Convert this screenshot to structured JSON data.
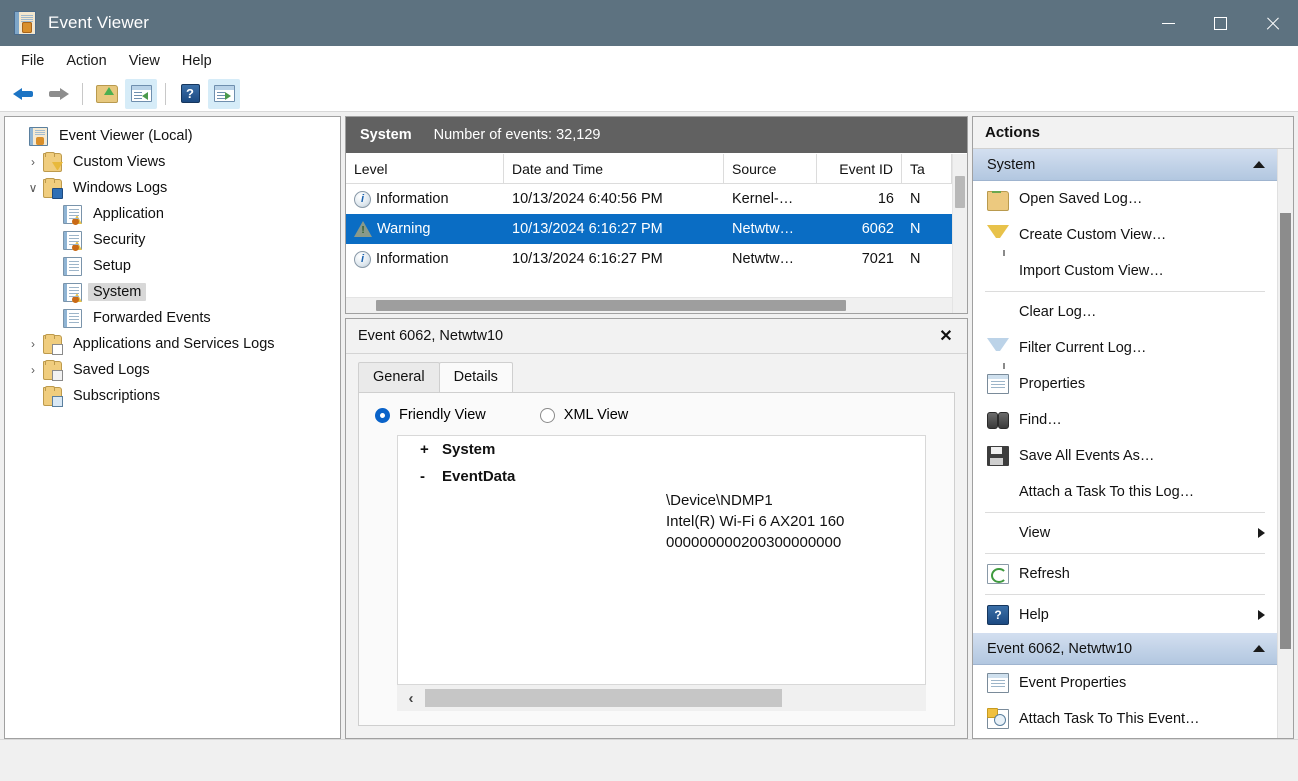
{
  "window": {
    "title": "Event Viewer",
    "icon": "event-viewer-icon",
    "controls": {
      "minimize": "–",
      "maximize": "□",
      "close": "✕"
    },
    "titlebar_color": "#5d7280"
  },
  "menubar": {
    "items": [
      {
        "label": "File"
      },
      {
        "label": "Action"
      },
      {
        "label": "View"
      },
      {
        "label": "Help"
      }
    ]
  },
  "toolbar": {
    "items": [
      {
        "name": "back-button",
        "icon": "arrow-left-icon",
        "active": false
      },
      {
        "name": "forward-button",
        "icon": "arrow-right-icon",
        "active": false
      },
      {
        "name": "up-one-level-button",
        "icon": "folder-up-icon",
        "active": false
      },
      {
        "name": "show-hide-console-tree-button",
        "icon": "pane-left-icon",
        "active": true
      },
      {
        "name": "help-button",
        "icon": "help-icon",
        "active": false,
        "glyph": "?"
      },
      {
        "name": "show-hide-action-pane-button",
        "icon": "pane-right-icon",
        "active": true
      }
    ]
  },
  "tree": {
    "items": [
      {
        "label": "Event Viewer (Local)",
        "icon": "event-log-icon",
        "indent": 0,
        "chevron": "",
        "selected": false
      },
      {
        "label": "Custom Views",
        "icon": "folder-filter-icon",
        "indent": 1,
        "chevron": "›",
        "selected": false
      },
      {
        "label": "Windows Logs",
        "icon": "folder-monitor-icon",
        "indent": 1,
        "chevron": "∨",
        "selected": false
      },
      {
        "label": "Application",
        "icon": "log-warning-icon",
        "indent": 2,
        "chevron": "",
        "selected": false
      },
      {
        "label": "Security",
        "icon": "log-warning-icon",
        "indent": 2,
        "chevron": "",
        "selected": false
      },
      {
        "label": "Setup",
        "icon": "log-icon",
        "indent": 2,
        "chevron": "",
        "selected": false
      },
      {
        "label": "System",
        "icon": "log-warning-icon",
        "indent": 2,
        "chevron": "",
        "selected": true
      },
      {
        "label": "Forwarded Events",
        "icon": "log-icon",
        "indent": 2,
        "chevron": "",
        "selected": false
      },
      {
        "label": "Applications and Services Logs",
        "icon": "folder-doc-icon",
        "indent": 1,
        "chevron": "›",
        "selected": false
      },
      {
        "label": "Saved Logs",
        "icon": "folder-docs-icon",
        "indent": 1,
        "chevron": "›",
        "selected": false
      },
      {
        "label": "Subscriptions",
        "icon": "folder-subscription-icon",
        "indent": 1,
        "chevron": "",
        "selected": false
      }
    ]
  },
  "event_list": {
    "banner_name": "System",
    "banner_count": "Number of events: 32,129",
    "columns": [
      "Level",
      "Date and Time",
      "Source",
      "Event ID",
      "Ta"
    ],
    "rows": [
      {
        "level": "Information",
        "level_icon": "information-icon",
        "date": "10/13/2024 6:40:56 PM",
        "source": "Kernel-…",
        "event_id": "16",
        "task": "N",
        "selected": false
      },
      {
        "level": "Warning",
        "level_icon": "warning-icon",
        "date": "10/13/2024 6:16:27 PM",
        "source": "Netwtw…",
        "event_id": "6062",
        "task": "N",
        "selected": true
      },
      {
        "level": "Information",
        "level_icon": "information-icon",
        "date": "10/13/2024 6:16:27 PM",
        "source": "Netwtw…",
        "event_id": "7021",
        "task": "N",
        "selected": false
      }
    ]
  },
  "detail": {
    "title": "Event 6062, Netwtw10",
    "close_label": "✕",
    "tabs": [
      {
        "label": "General",
        "active": false
      },
      {
        "label": "Details",
        "active": true
      }
    ],
    "view_options": [
      {
        "label": "Friendly View",
        "selected": true
      },
      {
        "label": "XML View",
        "selected": false
      }
    ],
    "xml": {
      "nodes": [
        {
          "sign": "+",
          "label": "System"
        },
        {
          "sign": "-",
          "label": "EventData"
        }
      ],
      "values": [
        "\\Device\\NDMP1",
        "Intel(R) Wi-Fi 6 AX201 160",
        "000000000200300000000"
      ]
    }
  },
  "actions": {
    "title": "Actions",
    "sections": [
      {
        "header": "System",
        "collapse_icon": "chevron-up-icon",
        "items": [
          {
            "label": "Open Saved Log…",
            "icon": "open-saved-log-icon",
            "submenu": false,
            "sep_after": false
          },
          {
            "label": "Create Custom View…",
            "icon": "funnel-yellow-icon",
            "submenu": false,
            "sep_after": false
          },
          {
            "label": "Import Custom View…",
            "icon": "none",
            "submenu": false,
            "sep_after": true
          },
          {
            "label": "Clear Log…",
            "icon": "none",
            "submenu": false,
            "sep_after": false
          },
          {
            "label": "Filter Current Log…",
            "icon": "funnel-blue-icon",
            "submenu": false,
            "sep_after": false
          },
          {
            "label": "Properties",
            "icon": "properties-icon",
            "submenu": false,
            "sep_after": false
          },
          {
            "label": "Find…",
            "icon": "binoculars-icon",
            "submenu": false,
            "sep_after": false
          },
          {
            "label": "Save All Events As…",
            "icon": "save-icon",
            "submenu": false,
            "sep_after": false
          },
          {
            "label": "Attach a Task To this Log…",
            "icon": "none",
            "submenu": false,
            "sep_after": true
          },
          {
            "label": "View",
            "icon": "none",
            "submenu": true,
            "sep_after": true
          },
          {
            "label": "Refresh",
            "icon": "refresh-icon",
            "submenu": false,
            "sep_after": true
          },
          {
            "label": "Help",
            "icon": "help-icon",
            "submenu": true,
            "sep_after": false
          }
        ]
      },
      {
        "header": "Event 6062, Netwtw10",
        "collapse_icon": "chevron-up-icon",
        "items": [
          {
            "label": "Event Properties",
            "icon": "properties-icon",
            "submenu": false,
            "sep_after": false
          },
          {
            "label": "Attach Task To This Event…",
            "icon": "attach-task-icon",
            "submenu": false,
            "sep_after": false
          }
        ]
      }
    ]
  }
}
